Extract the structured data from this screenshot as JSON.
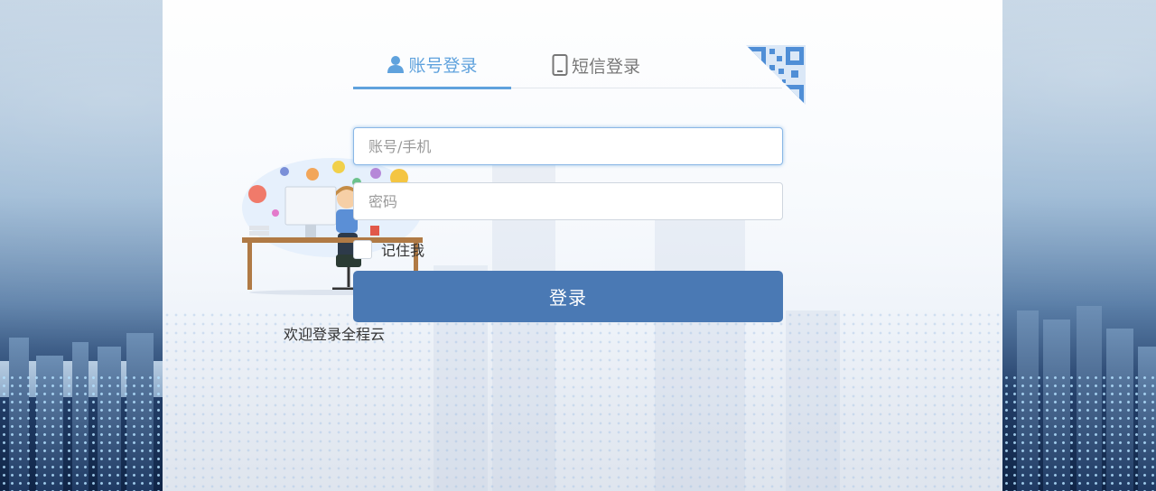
{
  "tabs": {
    "account_label": "账号登录",
    "sms_label": "短信登录"
  },
  "form": {
    "username_placeholder": "账号/手机",
    "username_value": "",
    "password_placeholder": "密码",
    "password_value": "",
    "remember_label": "记住我",
    "remember_checked": false,
    "login_label": "登录"
  },
  "welcome_text": "欢迎登录全程云",
  "icons": {
    "account_tab": "user-icon",
    "sms_tab": "mobile-phone-icon",
    "qr_toggle": "qr-code-icon"
  },
  "colors": {
    "accent": "#5fa2dd",
    "button": "#4a79b4",
    "text": "#333333",
    "muted": "#777777"
  }
}
